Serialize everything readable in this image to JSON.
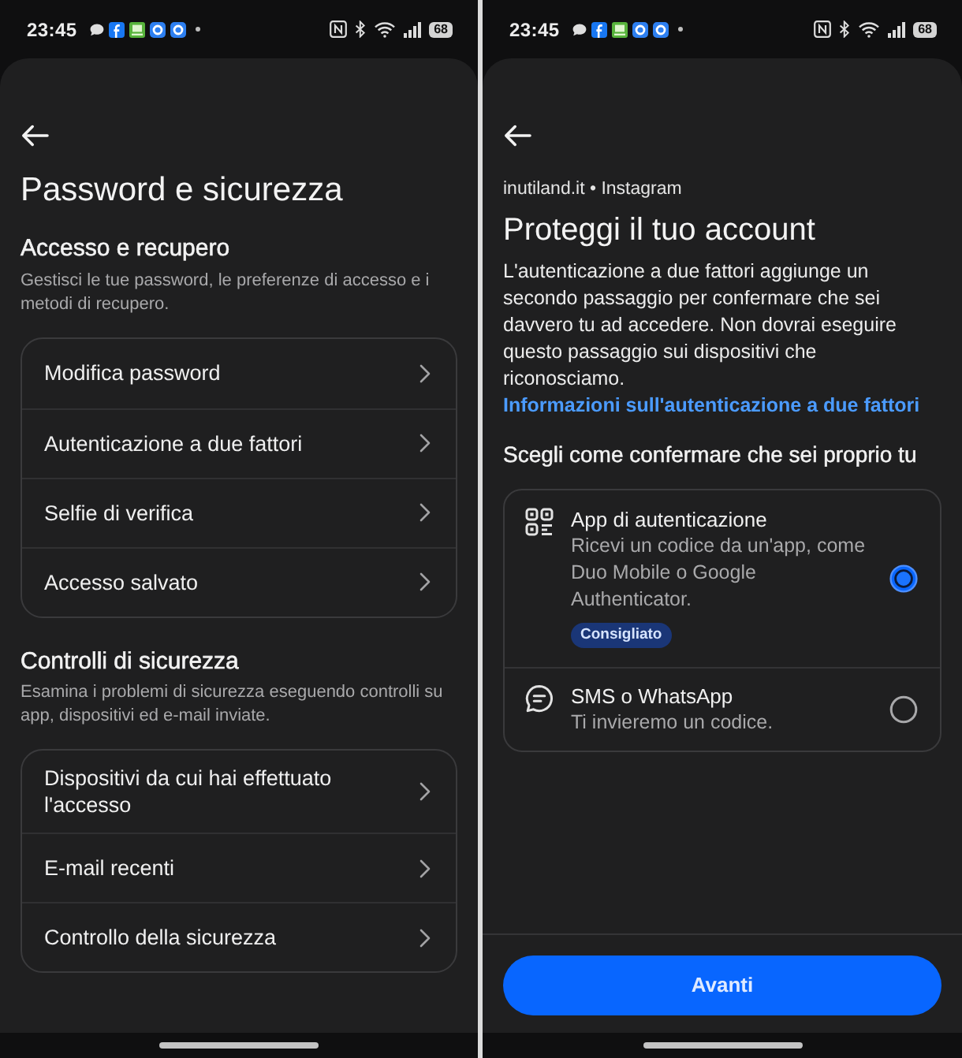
{
  "left_screen": {
    "status_bar": {
      "time": "23:45",
      "battery": "68"
    },
    "title": "Password e sicurezza",
    "sections": [
      {
        "heading": "Accesso e recupero",
        "description": "Gestisci le tue password, le preferenze di accesso e i metodi di recupero.",
        "items": [
          "Modifica password",
          "Autenticazione a due fattori",
          "Selfie di verifica",
          "Accesso salvato"
        ]
      },
      {
        "heading": "Controlli di sicurezza",
        "description": "Esamina i problemi di sicurezza eseguendo controlli su app, dispositivi ed e-mail inviate.",
        "items": [
          "Dispositivi da cui hai effettuato l'accesso",
          "E-mail recenti",
          "Controllo della sicurezza"
        ]
      }
    ]
  },
  "right_screen": {
    "status_bar": {
      "time": "23:45",
      "battery": "68"
    },
    "source": "inutiland.it • Instagram",
    "title": "Proteggi il tuo account",
    "intro": "L'autenticazione a due fattori aggiunge un secondo passaggio per confermare che sei davvero tu ad accedere. Non dovrai eseguire questo passaggio sui dispositivi che riconosciamo.",
    "link": "Informazioni sull'autenticazione a due fattori",
    "prompt": "Scegli come confermare che sei proprio tu",
    "options": [
      {
        "kind": "app",
        "title": "App di autenticazione",
        "description": "Ricevi un codice da un'app, come Duo Mobile o Google Authenticator.",
        "badge": "Consigliato",
        "selected": true
      },
      {
        "kind": "message",
        "title": "SMS o WhatsApp",
        "description": "Ti invieremo un codice.",
        "selected": false
      }
    ],
    "button": "Avanti"
  }
}
